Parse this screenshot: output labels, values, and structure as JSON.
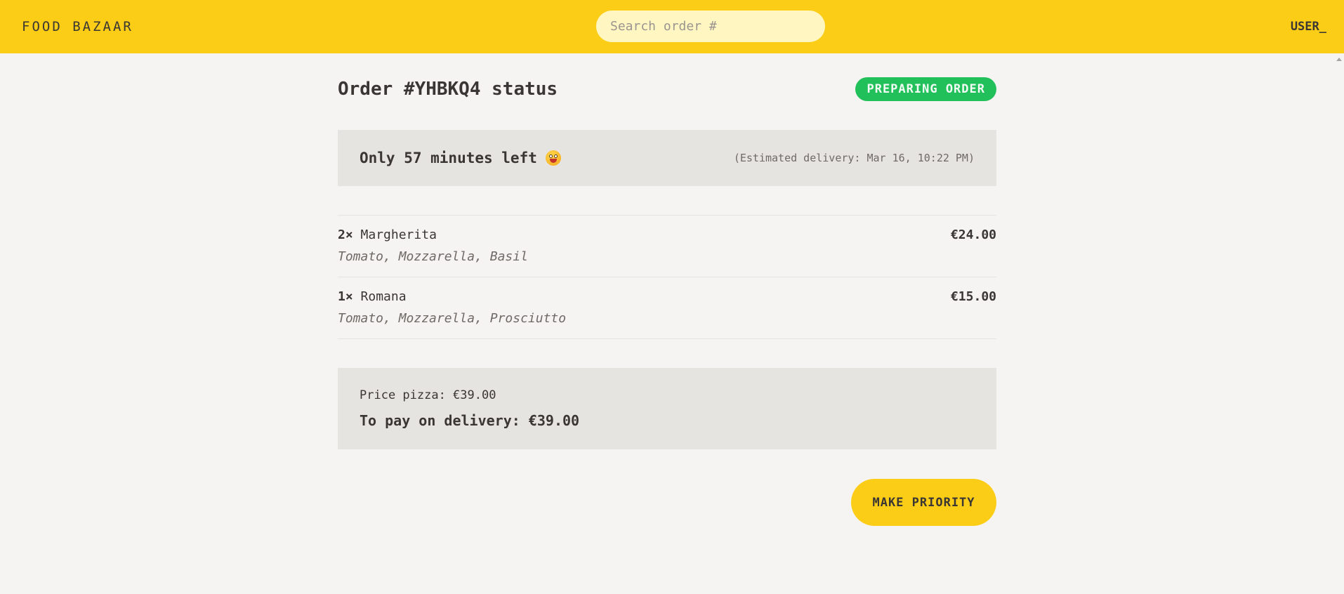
{
  "header": {
    "brand": "FOOD BAZAAR",
    "search_placeholder": "Search order #",
    "user": "USER_"
  },
  "order": {
    "title": "Order #YHBKQ4 status",
    "status": "PREPARING ORDER",
    "eta": {
      "text": "Only 57 minutes left",
      "emoji_icon": "grinning-face-icon",
      "delivery": "(Estimated delivery: Mar 16, 10:22 PM)"
    },
    "items": [
      {
        "qty": "2×",
        "name": "Margherita",
        "price": "€24.00",
        "ingredients": "Tomato, Mozzarella, Basil"
      },
      {
        "qty": "1×",
        "name": "Romana",
        "price": "€15.00",
        "ingredients": "Tomato, Mozzarella, Prosciutto"
      }
    ],
    "price_pizza": "Price pizza: €39.00",
    "to_pay": "To pay on delivery: €39.00",
    "priority_button": "MAKE PRIORITY"
  },
  "colors": {
    "accent": "#fbcd17",
    "status_green": "#22c05a",
    "background": "#f5f4f2",
    "panel": "#e6e4e1"
  }
}
